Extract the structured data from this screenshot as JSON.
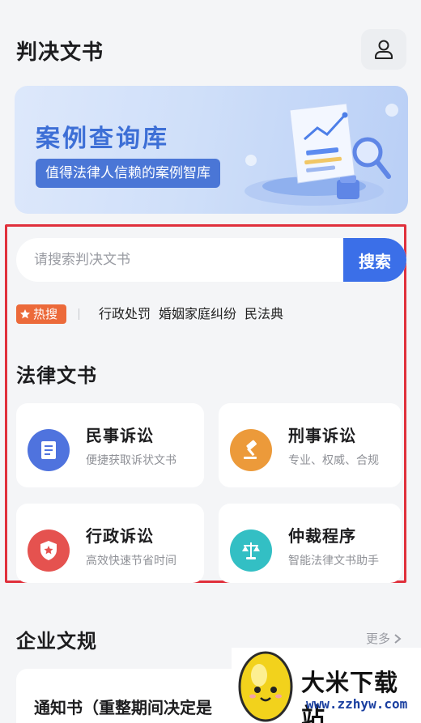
{
  "header": {
    "title": "判决文书",
    "user_icon": "user-icon"
  },
  "banner": {
    "title": "案例查询库",
    "subtitle": "值得法律人信赖的案例智库",
    "art_icon": "document-chart-magnifier-illustration"
  },
  "search": {
    "placeholder": "请搜索判决文书",
    "button_label": "搜索"
  },
  "hot": {
    "badge": "热搜",
    "tags": [
      "行政处罚",
      "婚姻家庭纠纷",
      "民法典"
    ]
  },
  "legal_docs": {
    "title": "法律文书",
    "cards": [
      {
        "title": "民事诉讼",
        "desc": "便捷获取诉状文书",
        "icon": "document-icon",
        "color": "#4f73de"
      },
      {
        "title": "刑事诉讼",
        "desc": "专业、权威、合规",
        "icon": "gavel-icon",
        "color": "#ec9a3a"
      },
      {
        "title": "行政诉讼",
        "desc": "高效快速节省时间",
        "icon": "shield-star-icon",
        "color": "#e5524f"
      },
      {
        "title": "仲裁程序",
        "desc": "智能法律文书助手",
        "icon": "scales-icon",
        "color": "#33bfc4"
      }
    ]
  },
  "enterprise": {
    "title": "企业文规",
    "more_label": "更多",
    "item_title": "通知书（重整期间决定是"
  },
  "watermark": {
    "name": "大米下载站",
    "url": "www.zzhyw.com"
  },
  "colors": {
    "accent": "#3b6fe8",
    "hot": "#ec6a3a",
    "highlight_border": "#e0303c"
  }
}
